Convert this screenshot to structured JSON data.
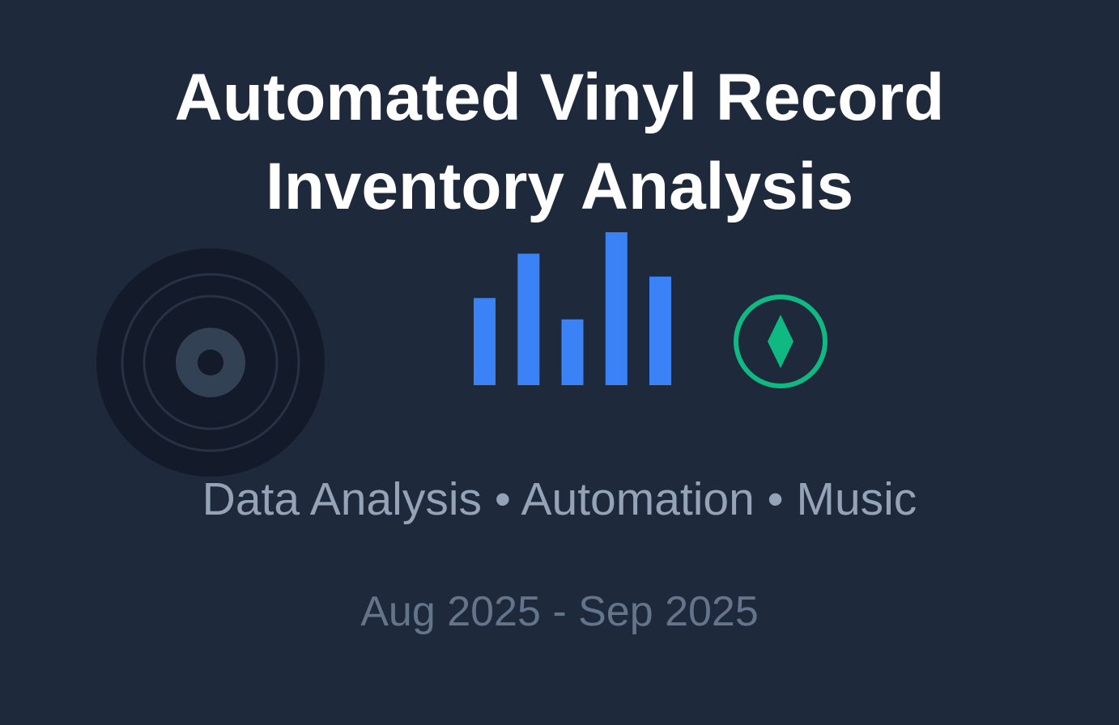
{
  "colors": {
    "background": "#1e293b",
    "title": "#ffffff",
    "subtitle": "#94a3b8",
    "date": "#64748b",
    "record_disc": "#131b2a",
    "record_grooves": "#273244",
    "record_label": "#334155",
    "bars": "#3b82f6",
    "emblem": "#10b981"
  },
  "title": {
    "line1": "Automated Vinyl Record",
    "line2": "Inventory Analysis"
  },
  "subtitle": "Data Analysis • Automation • Music",
  "date_range": "Aug 2025 - Sep 2025",
  "icons": {
    "record": "vinyl-record-icon",
    "bars": "bar-chart-icon",
    "emblem": "diamond-emblem-icon"
  },
  "decor_bar_levels": [
    0.57,
    0.86,
    0.43,
    1.0,
    0.71
  ]
}
